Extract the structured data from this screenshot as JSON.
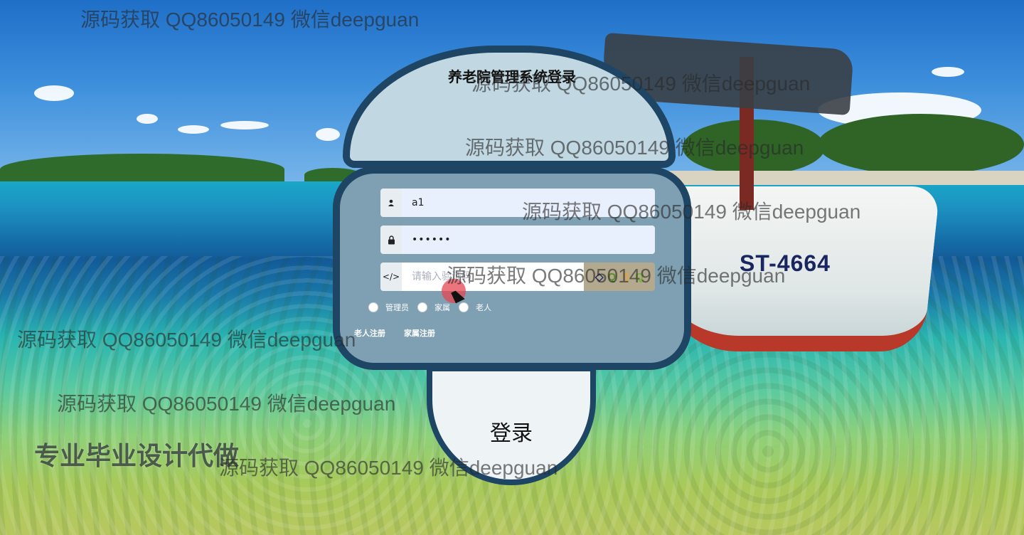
{
  "page": {
    "title": "养老院管理系统登录"
  },
  "form": {
    "username_value": "a1",
    "password_value": "••••••",
    "code_placeholder": "请输入验证码",
    "captcha_chars": [
      "◇",
      "Q",
      "う",
      "Q"
    ],
    "roles": [
      "管理员",
      "家属",
      "老人"
    ],
    "links": [
      "老人注册",
      "家属注册"
    ],
    "submit_label": "登录"
  },
  "scene": {
    "boat_label": "ST-4664"
  },
  "watermark": {
    "text": "源码获取 QQ86050149 微信deepguan",
    "promo": "专业毕业设计代做"
  },
  "colors": {
    "card_border": "#1e4563",
    "cap_fill": "#c1d8e2",
    "body_fill": "#7fa0b2",
    "stem_fill": "#eef3f6"
  },
  "icons": {
    "user": "user-icon",
    "lock": "lock-icon",
    "code": "code-icon"
  }
}
